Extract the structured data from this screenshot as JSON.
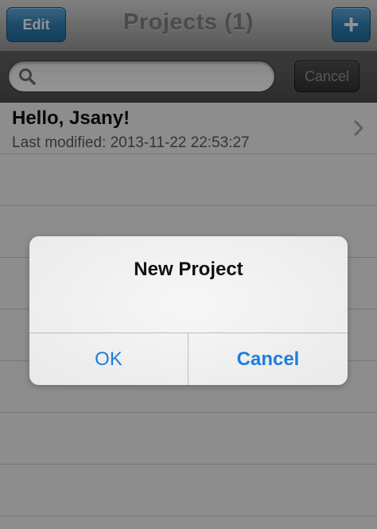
{
  "navbar": {
    "title": "Projects (1)",
    "edit_label": "Edit",
    "add_label": "+"
  },
  "search": {
    "value": "",
    "placeholder": "",
    "cancel_label": "Cancel"
  },
  "projects": [
    {
      "title": "Hello, Jsany!",
      "modified": "Last modified: 2013-11-22 22:53:27"
    }
  ],
  "alert": {
    "title": "New Project",
    "ok_label": "OK",
    "cancel_label": "Cancel"
  },
  "icons": {
    "search": "search-icon",
    "chevron": "chevron-right-icon"
  },
  "colors": {
    "accent_blue": "#1c7fdc",
    "nav_button": "#2d7aaa"
  }
}
